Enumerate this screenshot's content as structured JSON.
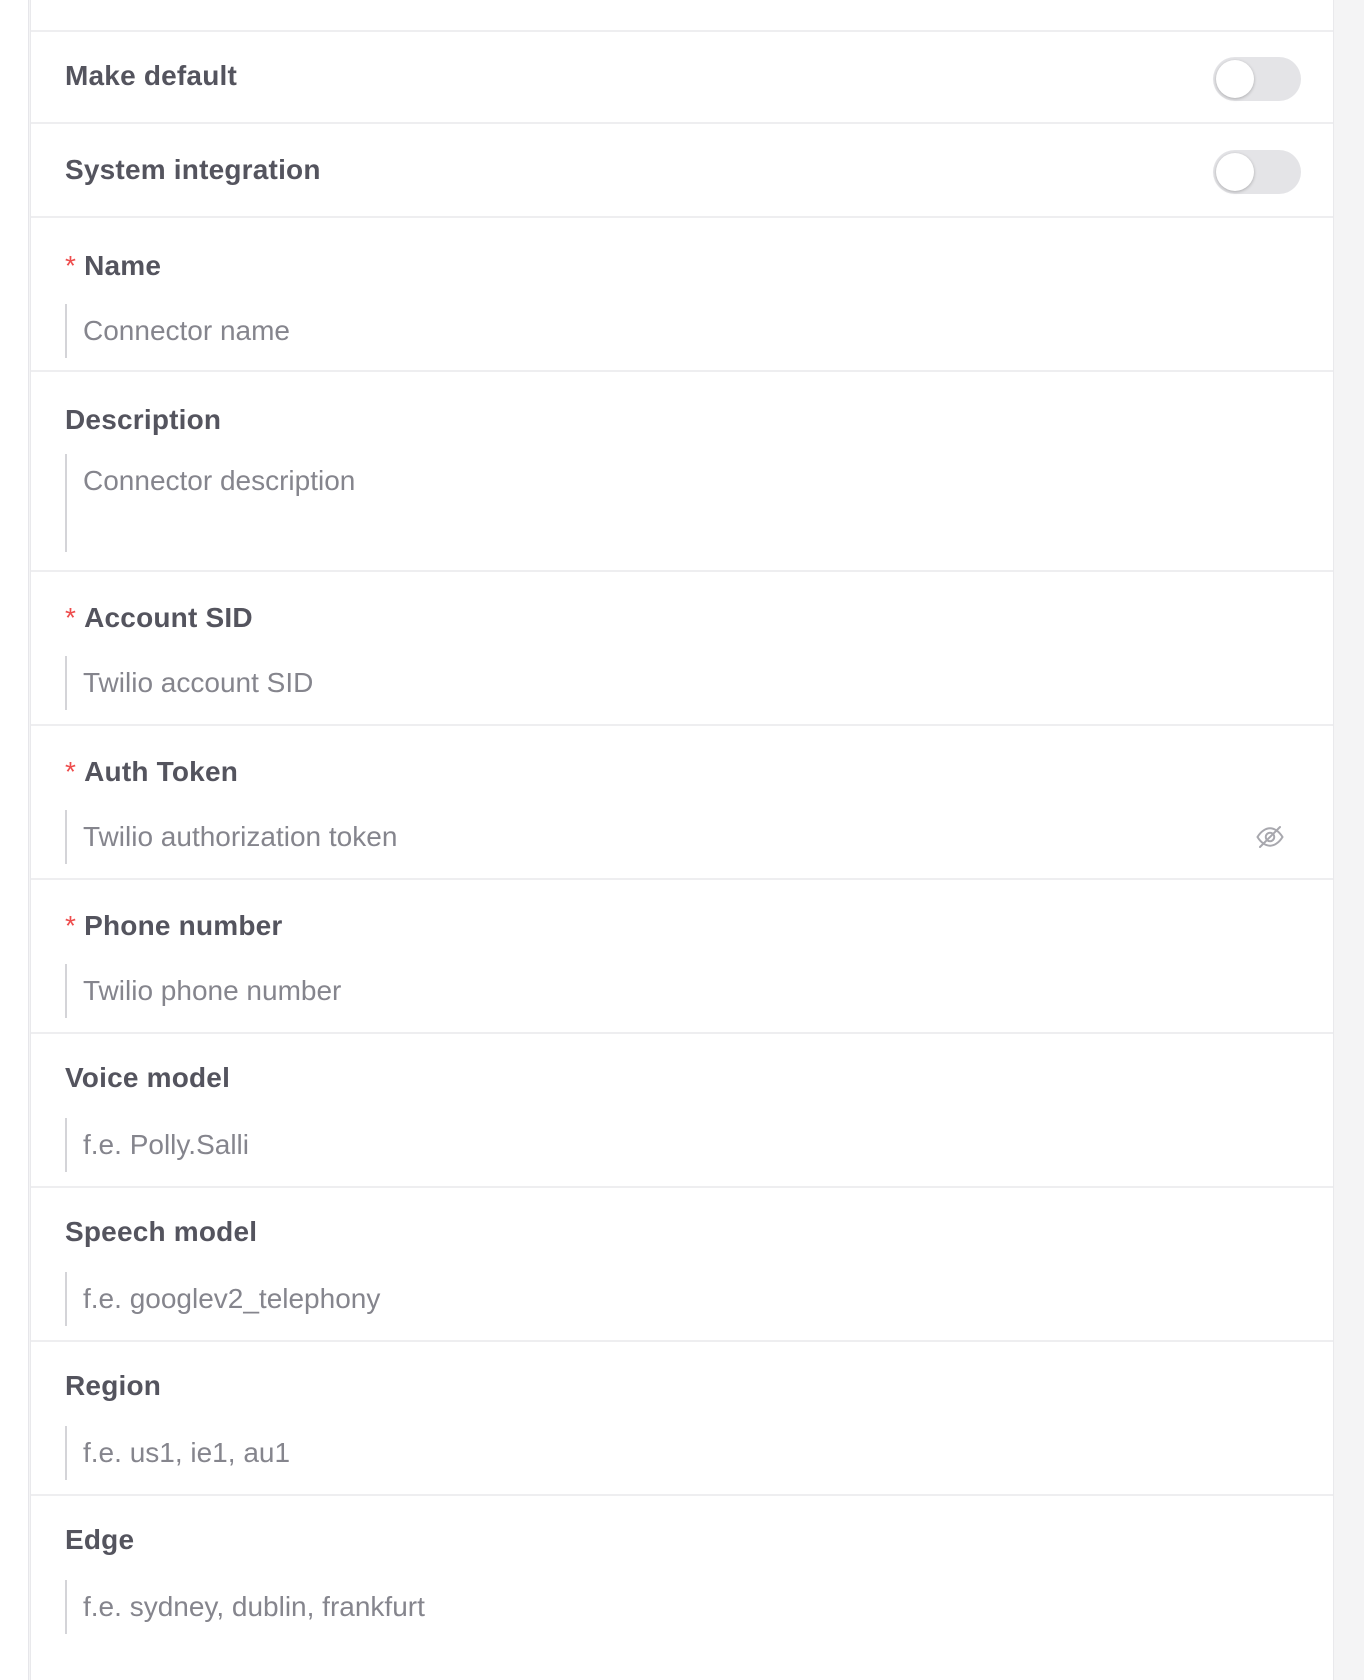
{
  "toggles": {
    "make_default": {
      "label": "Make default",
      "on": false
    },
    "system_integration": {
      "label": "System integration",
      "on": false
    }
  },
  "fields": {
    "name": {
      "label": "Name",
      "required": true,
      "placeholder": "Connector name"
    },
    "description": {
      "label": "Description",
      "required": false,
      "placeholder": "Connector description"
    },
    "account_sid": {
      "label": "Account SID",
      "required": true,
      "placeholder": "Twilio account SID"
    },
    "auth_token": {
      "label": "Auth Token",
      "required": true,
      "placeholder": "Twilio authorization token",
      "icon": "eye-slash-icon"
    },
    "phone_number": {
      "label": "Phone number",
      "required": true,
      "placeholder": "Twilio phone number"
    },
    "voice_model": {
      "label": "Voice model",
      "required": false,
      "placeholder": "f.e. Polly.Salli"
    },
    "speech_model": {
      "label": "Speech model",
      "required": false,
      "placeholder": "f.e. googlev2_telephony"
    },
    "region": {
      "label": "Region",
      "required": false,
      "placeholder": "f.e. us1, ie1, au1"
    },
    "edge": {
      "label": "Edge",
      "required": false,
      "placeholder": "f.e. sydney, dublin, frankfurt"
    }
  },
  "required_marker": "*",
  "colors": {
    "required": "#ee4d4d",
    "toggle_off": "#e4e4e7",
    "label": "#54545e",
    "placeholder": "#85858d"
  }
}
